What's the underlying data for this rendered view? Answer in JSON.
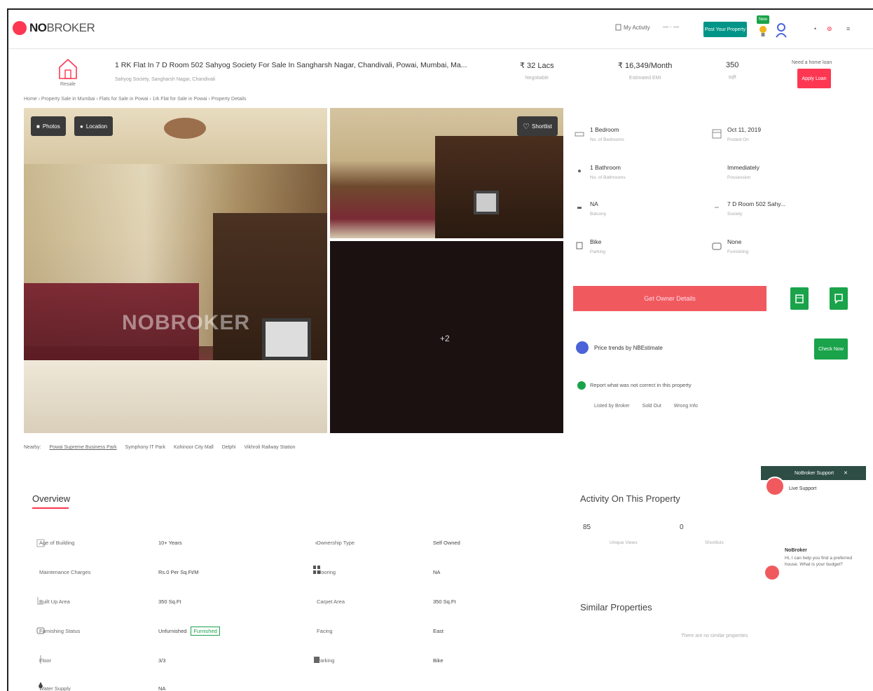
{
  "header": {
    "logo_bold": "NO",
    "logo_rest": "BROKER",
    "my_activity": "My Activity",
    "post_button": "Post Your Property",
    "new_badge": "New",
    "colors": {
      "brand": "#fd3752",
      "green": "#009587"
    }
  },
  "title": {
    "house_label": "Resale",
    "heading": "1 RK Flat In 7 D Room 502 Sahyog Society For Sale In Sangharsh Nagar, Chandivali, Powai, Mumbai, Ma...",
    "subheading": "Sahyog Society, Sangharsh Nagar, Chandivali"
  },
  "stats": [
    {
      "value": "₹ 32 Lacs",
      "label": "Negotiable"
    },
    {
      "value": "₹ 16,349/Month",
      "label": "Estimated EMI"
    },
    {
      "value": "350",
      "label": "sqft"
    }
  ],
  "rent_label": "Need a home loan",
  "apply_button": "Apply Loan",
  "breadcrumb": "Home › Property Sale in Mumbai › Flats for Sale in Powai › 1rk Flat for Sale in Powai › Property Details",
  "gallery": {
    "photos_btn": "Photos",
    "location_btn": "Location",
    "shortlist_btn": "Shortlist",
    "watermark": "NOBROKER",
    "more_count": "+2"
  },
  "nearby": {
    "label": "Nearby:",
    "items": [
      "Powai Supreme Business Park",
      "Symphony IT Park",
      "Kohinoor City Mall",
      "Delphi",
      "Vikhroli Railway Station"
    ]
  },
  "details": [
    {
      "value": "1 Bedroom",
      "label": "No. of Bedrooms",
      "icon": "bed-icon"
    },
    {
      "value": "Oct 11, 2019",
      "label": "Posted On",
      "icon": "calendar-icon"
    },
    {
      "value": "1 Bathroom",
      "label": "No. of Bathrooms",
      "icon": "bath-icon"
    },
    {
      "value": "Immediately",
      "label": "Possession",
      "icon": "clock-icon"
    },
    {
      "value": "NA",
      "label": "Balcony",
      "icon": "balcony-icon"
    },
    {
      "value": "7 D Room 502 Sahy...",
      "label": "Society",
      "icon": "building-icon"
    },
    {
      "value": "Bike",
      "label": "Parking",
      "icon": "parking-icon"
    },
    {
      "value": "None",
      "label": "Furnishing",
      "icon": "sofa-icon"
    }
  ],
  "owner_button": "Get Owner Details",
  "trend": {
    "text": "Price trends by NBEstimate",
    "button": "Check Now"
  },
  "report": {
    "text": "Report what was not correct in this property",
    "options": [
      "Listed by Broker",
      "Sold Out",
      "Wrong Info"
    ]
  },
  "overview": {
    "title": "Overview",
    "rows": [
      {
        "label": "Age of Building",
        "value": "10+ Years",
        "label2": "Ownership Type",
        "value2": "Self Owned"
      },
      {
        "label": "Maintenance Charges",
        "value": "Rs.0 Per Sq.Ft/M",
        "label2": "Flooring",
        "value2": "NA"
      },
      {
        "label": "Built Up Area",
        "value": "350 Sq.Ft",
        "label2": "Carpet Area",
        "value2": "350 Sq.Ft"
      },
      {
        "label": "Furnishing Status",
        "value": "Unfurnished",
        "value_tag": "Furnished",
        "label2": "Facing",
        "value2": "East"
      },
      {
        "label": "Floor",
        "value": "3/3",
        "label2": "Parking",
        "value2": "Bike"
      },
      {
        "label": "Water Supply",
        "value": "NA",
        "label2": "",
        "value2": ""
      }
    ]
  },
  "activity": {
    "title": "Activity On This Property",
    "views": "85",
    "views_label": "Unique Views",
    "shortlists": "0",
    "shortlists_label": "Shortlists"
  },
  "similar": {
    "title": "Similar Properties",
    "empty": "There are no similar properties"
  },
  "chat": {
    "header": "NoBroker Support",
    "live": "Live Support",
    "agent": "NoBroker",
    "message": "Hi, I can help you find a preferred house. What is your budget?"
  }
}
